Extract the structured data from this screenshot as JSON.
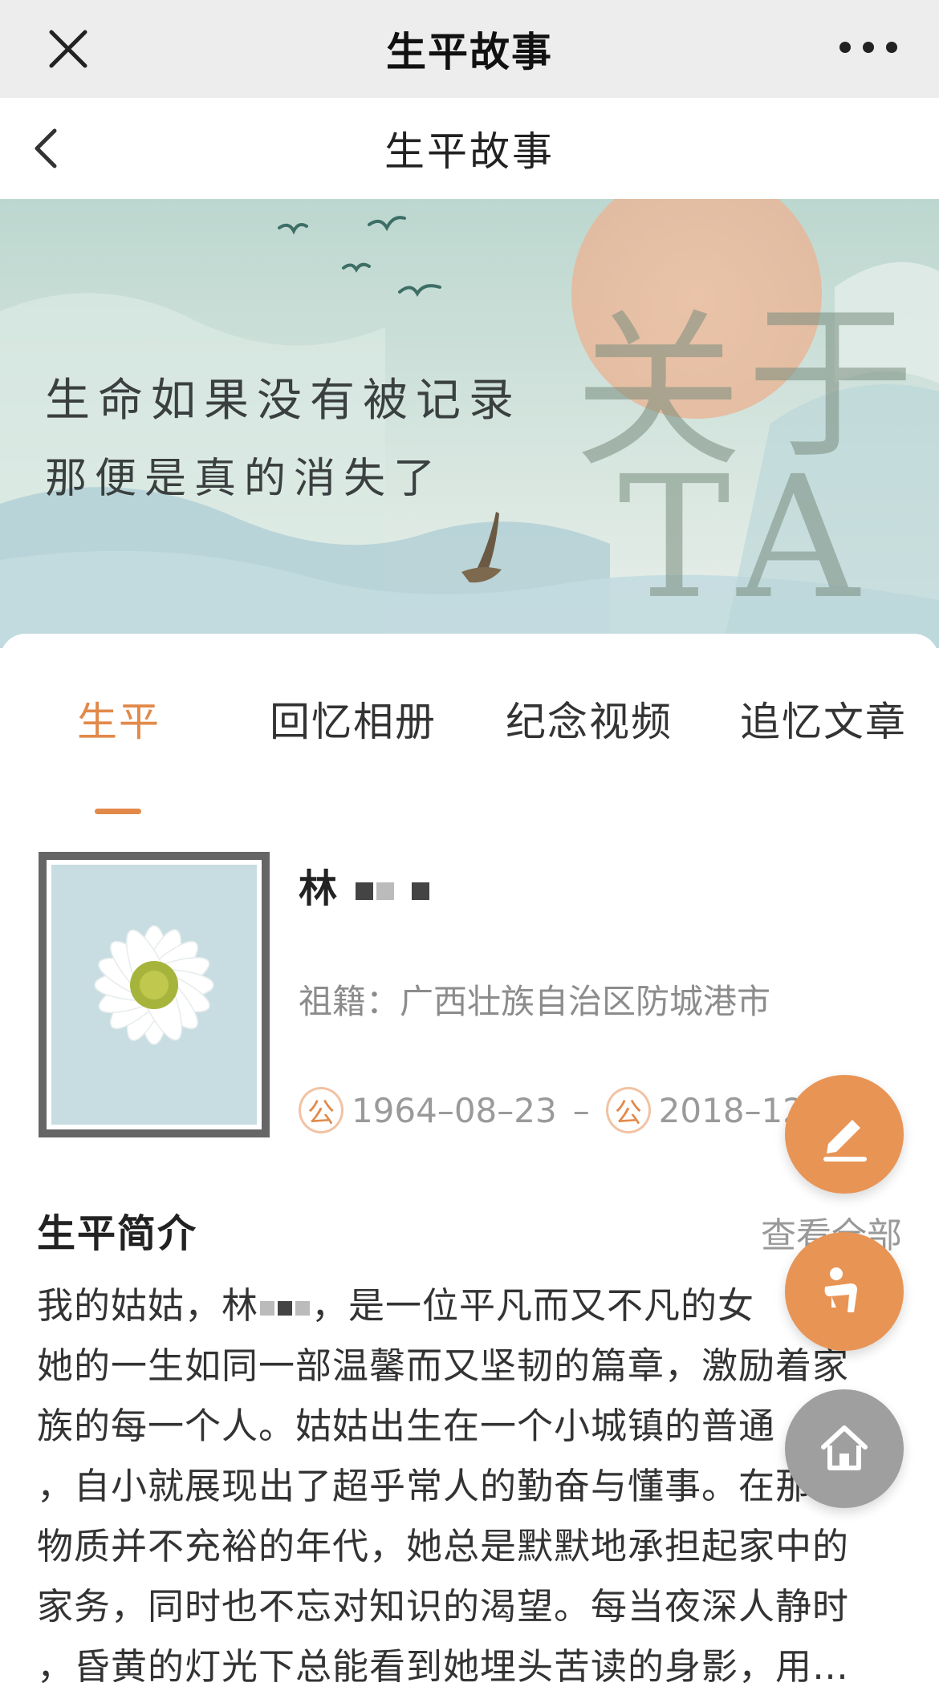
{
  "wechat_bar": {
    "title": "生平故事"
  },
  "header": {
    "title": "生平故事"
  },
  "banner": {
    "line1": "生命如果没有被记录",
    "line2": "那便是真的消失了",
    "big_text_1": "关",
    "big_text_2": "于",
    "big_text_3": "TA"
  },
  "tabs": [
    {
      "label": "生平",
      "active": true
    },
    {
      "label": "回忆相册",
      "active": false
    },
    {
      "label": "纪念视频",
      "active": false
    },
    {
      "label": "追忆文章",
      "active": false
    }
  ],
  "profile": {
    "name": "林",
    "origin": "祖籍：广西壮族自治区防城港市",
    "date_badge": "公",
    "birth": "1964–08–23",
    "separator": "–",
    "death": "2018–12"
  },
  "bio_section": {
    "title": "生平简介",
    "view_all": "查看全部",
    "lines": [
      "我的姑姑，林",
      "，是一位平凡而又不凡的女",
      "她的一生如同一部温馨而又坚韧的篇章，激励着家",
      "族的每一个人。姑姑出生在一个小城镇的普通",
      "，自小就展现出了超乎常人的勤奋与懂事。在那",
      "物质并不充裕的年代，她总是默默地承担起家中的",
      "家务，同时也不忘对知识的渴望。每当夜深人静时",
      "，昏黄的灯光下总能看到她埋头苦读的身影，用…"
    ]
  },
  "colors": {
    "accent": "#e2894a",
    "home_button": "#9f9f9f"
  }
}
